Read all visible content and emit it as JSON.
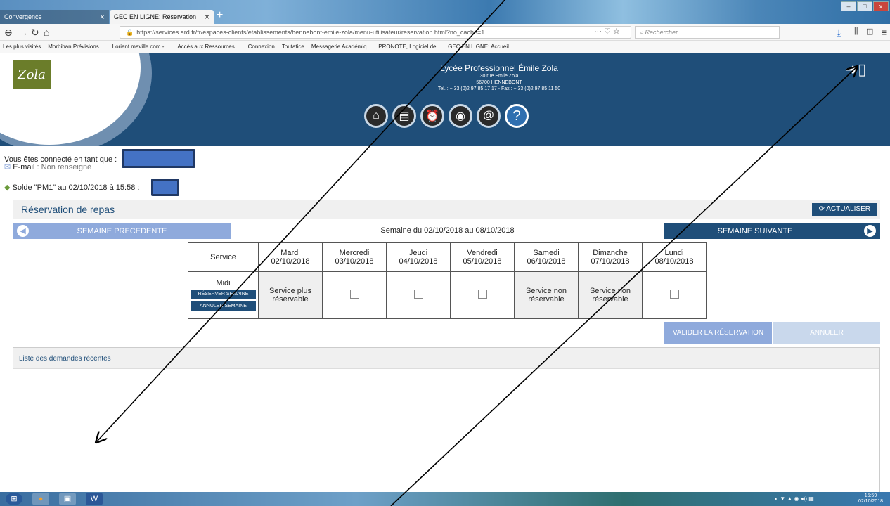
{
  "browser": {
    "tabs": [
      {
        "label": "Convergence"
      },
      {
        "label": "GEC EN LIGNE: Réservation"
      }
    ],
    "url": "https://services.ard.fr/fr/espaces-clients/etablissements/hennebont-emile-zola/menu-utilisateur/reservation.html?no_cache=1",
    "search_placeholder": "Rechercher",
    "bookmarks": [
      "Les plus visités",
      "Morbihan Prévisions ...",
      "Lorient.maville.com - ...",
      "Accès aux Ressources ...",
      "Connexion",
      "Toutatice",
      "Messagerie Académiq...",
      "PRONOTE, Logiciel de...",
      "GEC EN LIGNE: Accueil"
    ]
  },
  "header": {
    "logo_text": "Zola",
    "school_name": "Lycée Professionnel Émile Zola",
    "address1": "30 rue Emile Zola",
    "address2": "56700 HENNEBONT",
    "contact": "Tel. : + 33 (0)2 97 85 17 17 - Fax : + 33 (0)2 97 85 11 50"
  },
  "user": {
    "connected_label": "Vous êtes connecté en tant que :",
    "email_label": "E-mail",
    "email_value": ": Non renseigné",
    "solde_label": "Solde \"PM1\" au 02/10/2018 à 15:58 :"
  },
  "reservation": {
    "title": "Réservation de repas",
    "refresh_label": "ACTUALISER",
    "prev_week": "SEMAINE PRECEDENTE",
    "week_label": "Semaine du 02/10/2018 au 08/10/2018",
    "next_week": "SEMAINE SUIVANTE",
    "table": {
      "service_header": "Service",
      "days": [
        {
          "day": "Mardi",
          "date": "02/10/2018",
          "cell": "Service plus réservable",
          "gray": true
        },
        {
          "day": "Mercredi",
          "date": "03/10/2018",
          "cell": "",
          "gray": false
        },
        {
          "day": "Jeudi",
          "date": "04/10/2018",
          "cell": "",
          "gray": false
        },
        {
          "day": "Vendredi",
          "date": "05/10/2018",
          "cell": "",
          "gray": false
        },
        {
          "day": "Samedi",
          "date": "06/10/2018",
          "cell": "Service non réservable",
          "gray": true
        },
        {
          "day": "Dimanche",
          "date": "07/10/2018",
          "cell": "Service non réservable",
          "gray": true
        },
        {
          "day": "Lundi",
          "date": "08/10/2018",
          "cell": "",
          "gray": false
        }
      ],
      "service_name": "Midi",
      "reserve_week": "RÉSERVER SEMAINE",
      "cancel_week": "ANNULER SEMAINE"
    },
    "validate_label": "VALIDER LA RÉSERVATION",
    "cancel_label": "ANNULER"
  },
  "recent": {
    "title": "Liste des demandes récentes"
  },
  "taskbar": {
    "time": "15:59",
    "date": "02/10/2018"
  }
}
